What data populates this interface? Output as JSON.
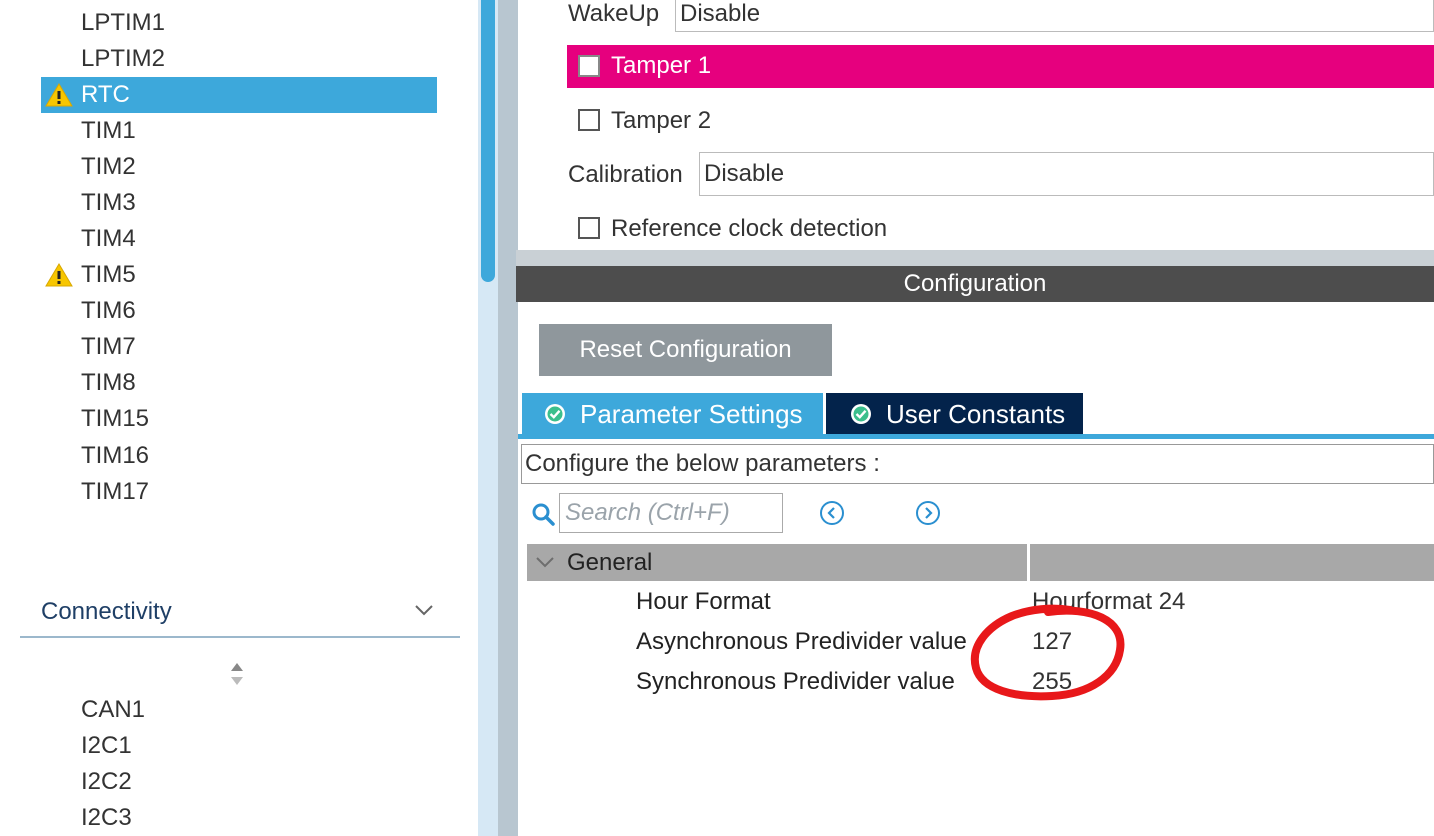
{
  "peripherals": {
    "timers": [
      {
        "label": "LPTIM1",
        "warning": false,
        "selected": false
      },
      {
        "label": "LPTIM2",
        "warning": false,
        "selected": false
      },
      {
        "label": "RTC",
        "warning": true,
        "selected": true
      },
      {
        "label": "TIM1",
        "warning": false,
        "selected": false
      },
      {
        "label": "TIM2",
        "warning": false,
        "selected": false
      },
      {
        "label": "TIM3",
        "warning": false,
        "selected": false
      },
      {
        "label": "TIM4",
        "warning": false,
        "selected": false
      },
      {
        "label": "TIM5",
        "warning": true,
        "selected": false
      },
      {
        "label": "TIM6",
        "warning": false,
        "selected": false
      },
      {
        "label": "TIM7",
        "warning": false,
        "selected": false
      },
      {
        "label": "TIM8",
        "warning": false,
        "selected": false
      },
      {
        "label": "TIM15",
        "warning": false,
        "selected": false
      },
      {
        "label": "TIM16",
        "warning": false,
        "selected": false
      },
      {
        "label": "TIM17",
        "warning": false,
        "selected": false
      }
    ],
    "connectivity_header": "Connectivity",
    "connectivity": [
      {
        "label": "CAN1"
      },
      {
        "label": "I2C1"
      },
      {
        "label": "I2C2"
      },
      {
        "label": "I2C3"
      }
    ]
  },
  "mode": {
    "wakeup_label": "WakeUp",
    "wakeup_value": "Disable",
    "tamper1_label": "Tamper 1",
    "tamper2_label": "Tamper 2",
    "calibration_label": "Calibration",
    "calibration_value": "Disable",
    "refclock_label": "Reference clock detection"
  },
  "configuration": {
    "header": "Configuration",
    "reset_button": "Reset Configuration",
    "tabs": [
      {
        "label": "Parameter Settings",
        "active": true
      },
      {
        "label": "User Constants",
        "active": false
      }
    ],
    "configure_text": "Configure the below parameters :",
    "search_placeholder": "Search (Ctrl+F)",
    "group": "General",
    "params": [
      {
        "name": "Hour Format",
        "value": "Hourformat 24"
      },
      {
        "name": "Asynchronous Predivider value",
        "value": "127"
      },
      {
        "name": "Synchronous Predivider value",
        "value": "255"
      }
    ]
  },
  "colors": {
    "selection": "#3da8db",
    "tamper_highlight": "#e6007e",
    "user_tab": "#03234b",
    "annotation": "#e8181a"
  }
}
